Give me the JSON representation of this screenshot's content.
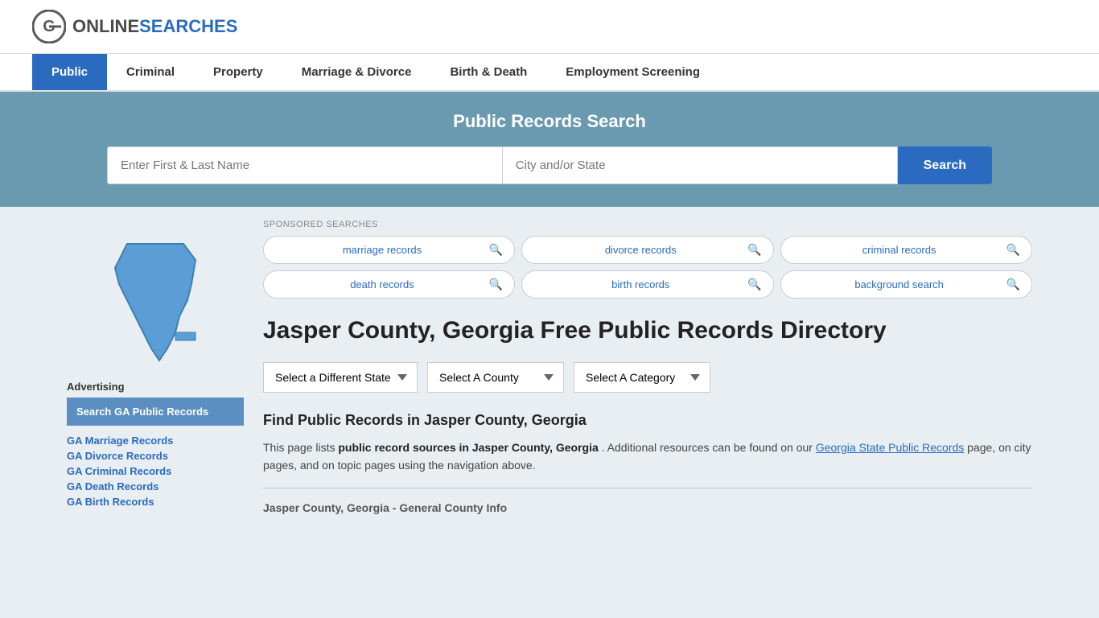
{
  "site": {
    "logo_online": "ONLINE",
    "logo_searches": "SEARCHES",
    "tagline": "Public Records Search"
  },
  "nav": {
    "items": [
      {
        "label": "Public",
        "active": true
      },
      {
        "label": "Criminal",
        "active": false
      },
      {
        "label": "Property",
        "active": false
      },
      {
        "label": "Marriage & Divorce",
        "active": false
      },
      {
        "label": "Birth & Death",
        "active": false
      },
      {
        "label": "Employment Screening",
        "active": false
      }
    ]
  },
  "hero": {
    "title": "Public Records Search",
    "name_placeholder": "Enter First & Last Name",
    "location_placeholder": "City and/or State",
    "search_button": "Search"
  },
  "sponsored": {
    "label": "SPONSORED SEARCHES",
    "items": [
      {
        "text": "marriage records"
      },
      {
        "text": "divorce records"
      },
      {
        "text": "criminal records"
      },
      {
        "text": "death records"
      },
      {
        "text": "birth records"
      },
      {
        "text": "background search"
      }
    ]
  },
  "page": {
    "title": "Jasper County, Georgia Free Public Records Directory",
    "dropdowns": {
      "state": "Select a Different State",
      "county": "Select A County",
      "category": "Select A Category"
    },
    "find_heading": "Find Public Records in Jasper County, Georgia",
    "body_intro": "This page lists",
    "body_bold": "public record sources in Jasper County, Georgia",
    "body_middle": ". Additional resources can be found on our",
    "body_link": "Georgia State Public Records",
    "body_end": " page, on city pages, and on topic pages using the navigation above.",
    "county_info_label": "Jasper County, Georgia - General County Info"
  },
  "sidebar": {
    "advertising_label": "Advertising",
    "ad_button": "Search GA Public Records",
    "links": [
      {
        "text": "GA Marriage Records"
      },
      {
        "text": "GA Divorce Records"
      },
      {
        "text": "GA Criminal Records"
      },
      {
        "text": "GA Death Records"
      },
      {
        "text": "GA Birth Records"
      }
    ]
  },
  "colors": {
    "primary_blue": "#2a6bbf",
    "hero_bg": "#6a9ab0",
    "map_fill": "#5b9ed6"
  }
}
